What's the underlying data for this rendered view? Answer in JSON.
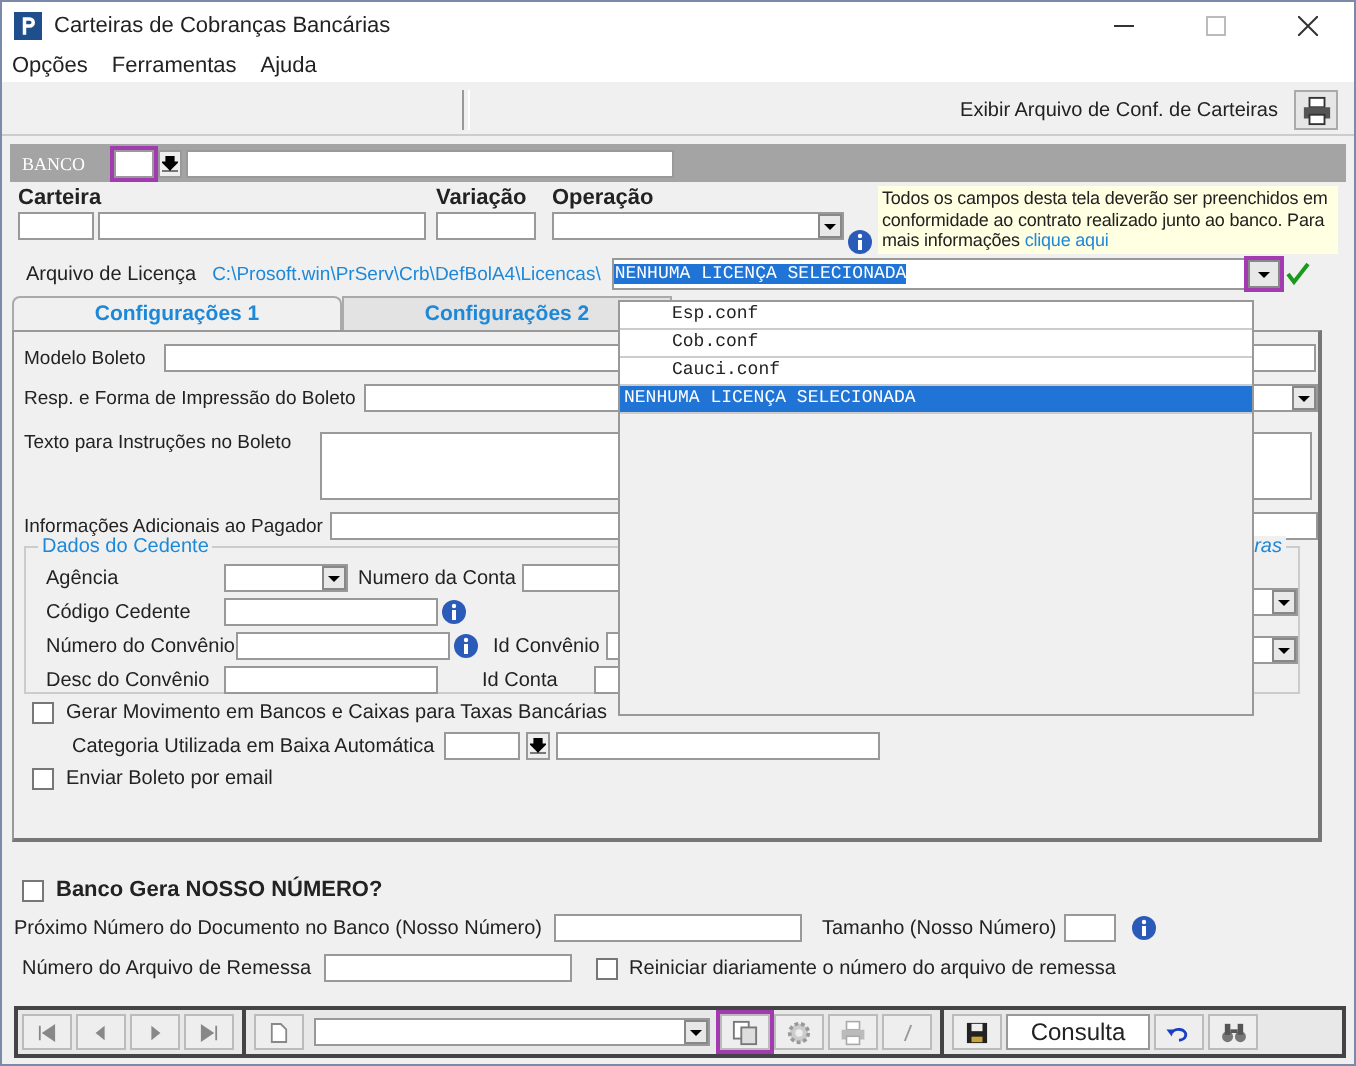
{
  "window": {
    "title": "Carteiras de Cobranças Bancárias"
  },
  "menu": [
    "Opções",
    "Ferramentas",
    "Ajuda"
  ],
  "toolbar": {
    "label": "Exibir Arquivo de Conf. de Carteiras"
  },
  "banco": {
    "label": "BANCO"
  },
  "header_labels": [
    "Carteira",
    "Variação",
    "Operação"
  ],
  "note": {
    "text": "Todos os campos desta tela deverão ser preenchidos em conformidade ao contrato realizado junto ao banco. Para mais informações",
    "link": "clique aqui"
  },
  "license": {
    "label": "Arquivo de Licença",
    "path": "C:\\Prosoft.win\\PrServ\\Crb\\DefBolA4\\Licencas\\",
    "value": "NENHUMA LICENÇA SELECIONADA",
    "options": [
      {
        "label": "Esp.conf",
        "selected": false
      },
      {
        "label": "Cob.conf",
        "selected": false
      },
      {
        "label": "Cauci.conf",
        "selected": false
      },
      {
        "label": "NENHUMA LICENÇA SELECIONADA",
        "selected": true
      }
    ]
  },
  "tabs": [
    {
      "label": "Configurações 1",
      "selected": true
    },
    {
      "label": "Configurações 2",
      "selected": false
    }
  ],
  "config": {
    "modelo": "Modelo Boleto",
    "resp": "Resp. e Forma de Impressão do Boleto",
    "texto": "Texto para Instruções no Boleto",
    "info": "Informações Adicionais ao Pagador"
  },
  "cedente": {
    "title": "Dados do Cedente",
    "agencia": "Agência",
    "numero_conta": "Numero da Conta",
    "codigo": "Código Cedente",
    "numero_convenio": "Número do Convênio",
    "id_convenio": "Id Convênio",
    "desc": "Desc do Convênio",
    "id_conta": "Id Conta"
  },
  "group_2": {
    "title": "ras"
  },
  "gerar": {
    "label": "Gerar Movimento em Bancos e Caixas  para Taxas Bancárias",
    "checked": false
  },
  "categoria": "Categoria Utilizada em Baixa Automática",
  "enviar": {
    "label": "Enviar Boleto por email",
    "checked": false
  },
  "nosso_numero": {
    "label": "Banco Gera NOSSO NÚMERO?",
    "checked": false,
    "proximo": "Próximo Número do Documento no Banco (Nosso Número)",
    "tamanho": "Tamanho (Nosso Número)",
    "remessa": "Número do Arquivo de Remessa"
  },
  "reiniciar": {
    "label": "Reiniciar diariamente o número do arquivo de remessa",
    "checked": false
  },
  "navbar": {
    "mode": "Consulta"
  }
}
